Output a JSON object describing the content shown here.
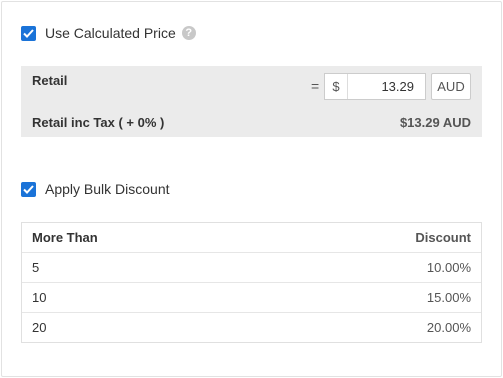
{
  "use_calculated_price": {
    "label": "Use Calculated Price",
    "checked": true,
    "help_icon": "question-mark-icon"
  },
  "retail": {
    "label": "Retail",
    "equals": "=",
    "currency_symbol": "$",
    "value": "13.29",
    "currency_button": "AUD",
    "tax_label": "Retail inc Tax ( + 0% )",
    "tax_value": "$13.29 AUD"
  },
  "apply_bulk_discount": {
    "label": "Apply Bulk Discount",
    "checked": true
  },
  "bulk_table": {
    "headers": [
      "More Than",
      "Discount"
    ],
    "rows": [
      {
        "more_than": "5",
        "discount": "10.00%"
      },
      {
        "more_than": "10",
        "discount": "15.00%"
      },
      {
        "more_than": "20",
        "discount": "20.00%"
      }
    ]
  },
  "colors": {
    "accent": "#1a73d8",
    "panel_bg": "#ebebeb",
    "border": "#e0e0e0"
  }
}
